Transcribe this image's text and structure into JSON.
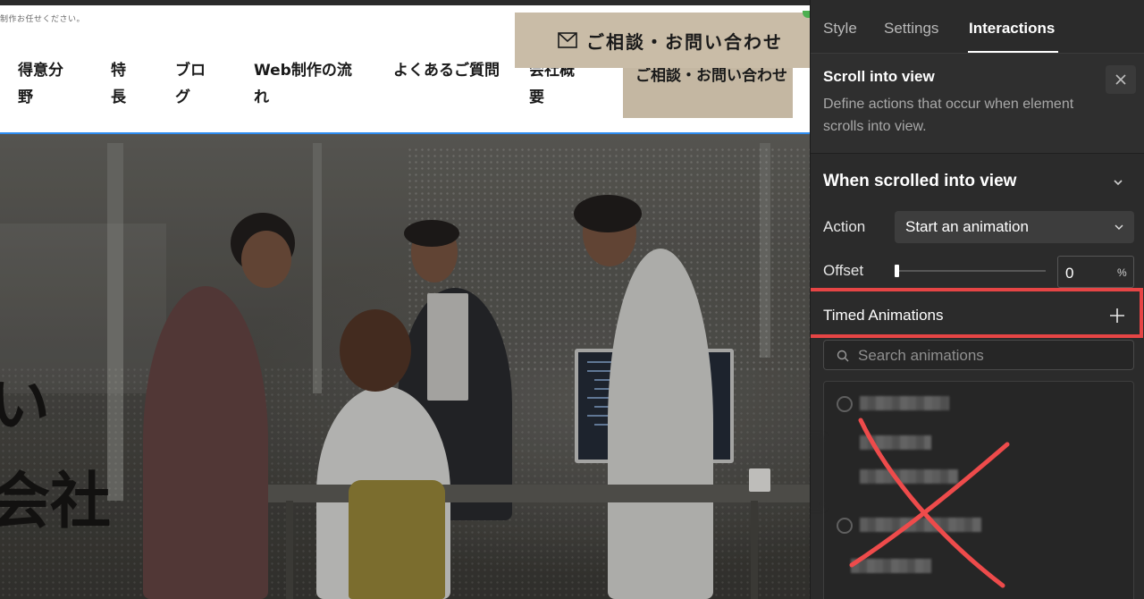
{
  "site": {
    "tagline": "制作お任せください。",
    "nav": [
      "得意分野",
      "特長",
      "ブログ",
      "Web制作の流れ",
      "よくあるご質問",
      "会社概要"
    ],
    "nav_contact": "ご相談・お問い合わせ",
    "contact_button": "ご相談・お問い合わせ",
    "hero_line1": "い",
    "hero_line2": "会社",
    "mail_icon": "mail-icon",
    "accent_beige": "#c9bca7",
    "selection_blue": "#2d8cf0"
  },
  "panel": {
    "tabs": [
      {
        "label": "Style",
        "active": false
      },
      {
        "label": "Settings",
        "active": false
      },
      {
        "label": "Interactions",
        "active": true
      }
    ],
    "trigger": {
      "title": "Scroll into view",
      "description": "Define actions that occur when element scrolls into view.",
      "close_icon": "close-icon"
    },
    "section": {
      "title": "When scrolled into view",
      "chevron": "chevron-down-icon"
    },
    "action": {
      "label": "Action",
      "value": "Start an animation"
    },
    "offset": {
      "label": "Offset",
      "value": "0",
      "unit": "%",
      "level": 0
    },
    "timed": {
      "label": "Timed Animations",
      "add_icon": "plus-icon"
    },
    "search": {
      "placeholder": "Search animations"
    },
    "highlight_color": "#e64545"
  }
}
